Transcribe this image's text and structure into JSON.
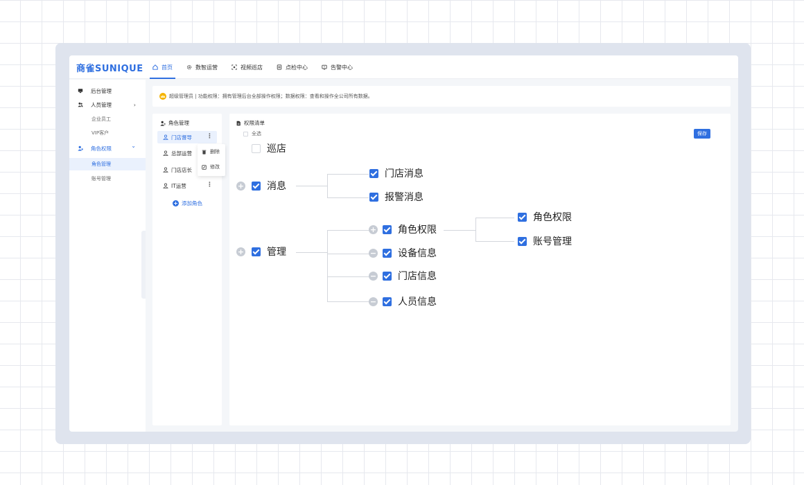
{
  "app": {
    "logo": "商雀SUNIQUE",
    "nav": [
      {
        "label": "首页",
        "icon": "home-icon",
        "active": true
      },
      {
        "label": "数智运营",
        "icon": "gear-icon",
        "active": false
      },
      {
        "label": "视频巡店",
        "icon": "camera-scan-icon",
        "active": false
      },
      {
        "label": "点检中心",
        "icon": "checklist-icon",
        "active": false
      },
      {
        "label": "告警中心",
        "icon": "alert-icon",
        "active": false
      }
    ]
  },
  "sidebar": {
    "items": [
      {
        "label": "后台管理",
        "icon": "monitor-icon"
      },
      {
        "label": "人员管理",
        "icon": "users-icon",
        "arrow": "›"
      },
      {
        "label": "企业员工"
      },
      {
        "label": "VIP客户"
      },
      {
        "label": "角色权限",
        "icon": "user-role-icon",
        "arrow": "⌄"
      },
      {
        "label": "角色管理",
        "active": true
      },
      {
        "label": "账号管理"
      }
    ]
  },
  "notice": {
    "text": "超级管理员 | 功能权限：拥有管理后台全部操作权限；数据权限：查看和操作全公司所有数据。"
  },
  "roles": {
    "title": "角色管理",
    "items": [
      "门店督导",
      "总部运营",
      "门店店长",
      "IT运营"
    ],
    "menu": {
      "delete": "删除",
      "edit": "修改"
    },
    "more": "⋮",
    "add_label": "添加角色"
  },
  "permissions": {
    "title": "权限清单",
    "select_all": "全选",
    "save_label": "保存",
    "tree": {
      "patrol": {
        "label": "巡店",
        "checked": false
      },
      "message": {
        "label": "消息",
        "checked": true,
        "children": [
          {
            "label": "门店消息",
            "checked": true
          },
          {
            "label": "报警消息",
            "checked": true
          }
        ]
      },
      "manage": {
        "label": "管理",
        "checked": true,
        "children": [
          {
            "label": "角色权限",
            "checked": true,
            "children": [
              {
                "label": "角色权限",
                "checked": true
              },
              {
                "label": "账号管理",
                "checked": true
              }
            ]
          },
          {
            "label": "设备信息",
            "checked": true
          },
          {
            "label": "门店信息",
            "checked": true
          },
          {
            "label": "人员信息",
            "checked": true
          }
        ]
      }
    },
    "toggles": {
      "expand": "+",
      "collapse": "−"
    }
  },
  "colors": {
    "accent": "#2f6fe0",
    "frame": "#dfe4ee",
    "toggle": "#c7ccd4"
  }
}
